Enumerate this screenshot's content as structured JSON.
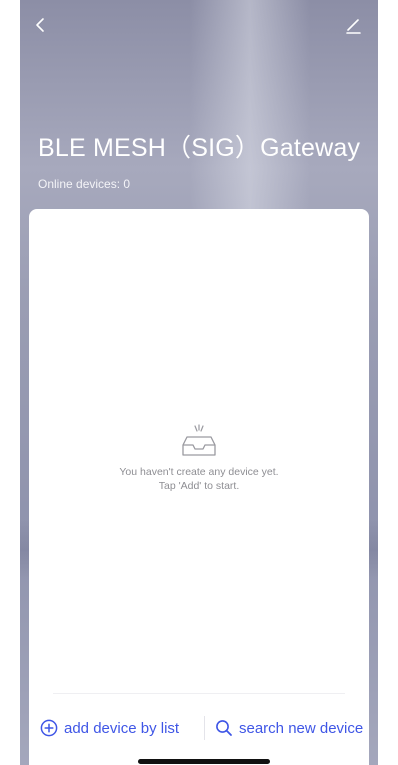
{
  "header": {
    "title": "BLE MESH（SIG）Gateway",
    "online_devices": "Online devices: 0"
  },
  "empty_state": {
    "line1": "You haven't create any device yet.",
    "line2": "Tap 'Add' to start."
  },
  "actions": {
    "add_label": "add device by list",
    "search_label": "search new device"
  },
  "icons": {
    "back": "chevron-left-icon",
    "edit": "pencil-icon",
    "empty": "empty-tray-icon",
    "add": "plus-circle-icon",
    "search": "search-icon"
  },
  "colors": {
    "accent": "#3f56e6",
    "empty_text": "#8e8e93"
  }
}
